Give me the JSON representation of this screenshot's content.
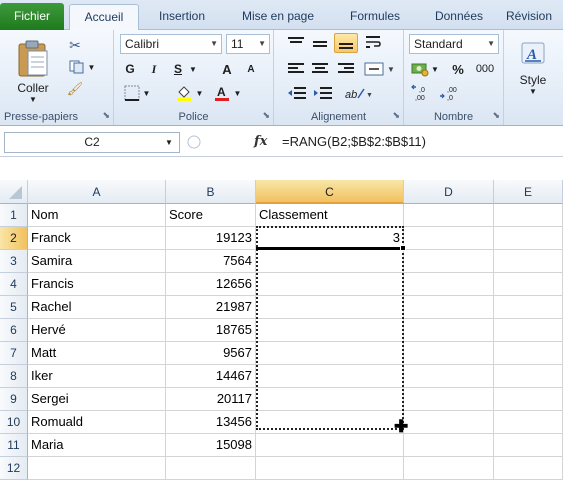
{
  "ribbon_tabs": [
    "Fichier",
    "Accueil",
    "Insertion",
    "Mise en page",
    "Formules",
    "Données",
    "Révision"
  ],
  "clipboard": {
    "paste_label": "Coller",
    "group_label": "Presse-papiers"
  },
  "font": {
    "name": "Calibri",
    "size": "11",
    "bold": "G",
    "italic": "I",
    "underline": "S",
    "grow": "A",
    "shrink": "A",
    "group_label": "Police"
  },
  "alignment": {
    "group_label": "Alignement"
  },
  "number": {
    "format": "Standard",
    "percent": "%",
    "thousands": "000",
    "group_label": "Nombre"
  },
  "style": {
    "label": "Style"
  },
  "formula_bar": {
    "name_box": "C2",
    "fx": "fx",
    "formula": "=RANG(B2;$B$2:$B$11)"
  },
  "columns": [
    "A",
    "B",
    "C",
    "D",
    "E"
  ],
  "rows": [
    "1",
    "2",
    "3",
    "4",
    "5",
    "6",
    "7",
    "8",
    "9",
    "10",
    "11",
    "12"
  ],
  "sheet": [
    [
      "Nom",
      "Score",
      "Classement"
    ],
    [
      "Franck",
      "19123",
      "3"
    ],
    [
      "Samira",
      "7564",
      ""
    ],
    [
      "Francis",
      "12656",
      ""
    ],
    [
      "Rachel",
      "21987",
      ""
    ],
    [
      "Hervé",
      "18765",
      ""
    ],
    [
      "Matt",
      "9567",
      ""
    ],
    [
      "Iker",
      "14467",
      ""
    ],
    [
      "Sergei",
      "20117",
      ""
    ],
    [
      "Romuald",
      "13456",
      ""
    ],
    [
      "Maria",
      "15098",
      ""
    ]
  ],
  "colors": {
    "file_tab": "#2a8a28",
    "selection_header": "#f1c15f",
    "ribbon_text": "#1e395b"
  }
}
